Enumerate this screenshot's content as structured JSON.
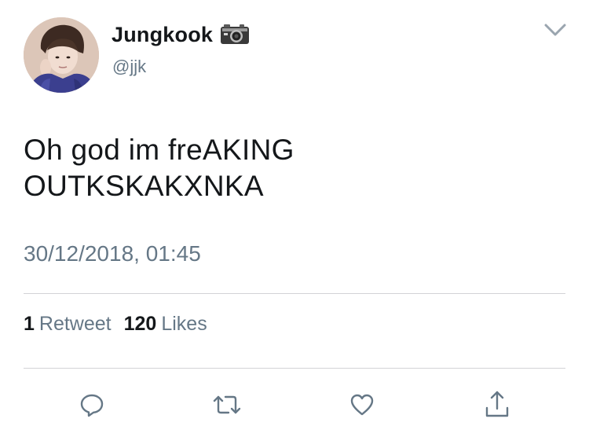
{
  "tweet": {
    "author": {
      "display_name": "Jungkook",
      "handle": "@jjk",
      "name_emoji_icon": "camera-icon"
    },
    "text": "Oh god im freAKING\nOUTKSKAKXNKA",
    "timestamp": "30/12/2018, 01:45",
    "stats": {
      "retweets_count": "1",
      "retweets_label": "Retweet",
      "likes_count": "120",
      "likes_label": "Likes"
    },
    "actions": [
      {
        "name": "reply",
        "icon": "speech-bubble-icon"
      },
      {
        "name": "retweet",
        "icon": "retweet-arrows-icon"
      },
      {
        "name": "like",
        "icon": "heart-outline-icon"
      },
      {
        "name": "share",
        "icon": "share-upload-icon"
      }
    ],
    "menu_icon": "chevron-down-icon"
  },
  "colors": {
    "primary_text": "#14171a",
    "secondary_text": "#657786",
    "icon_gray": "#657786",
    "divider": "#d3d3d6"
  }
}
